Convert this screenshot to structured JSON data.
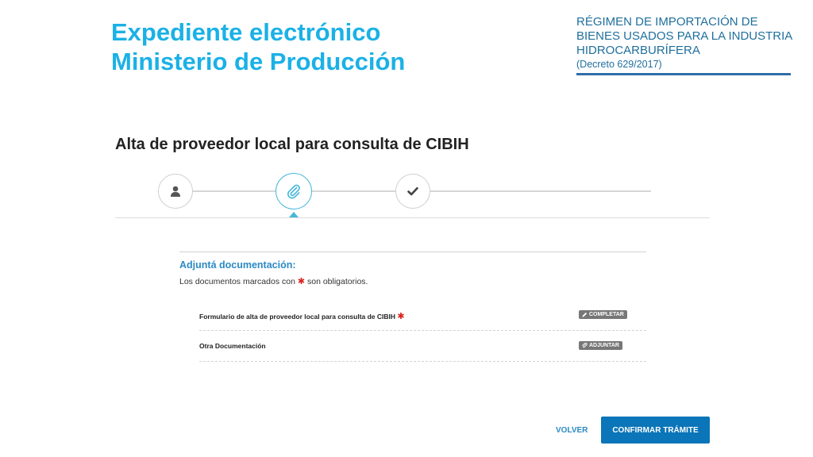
{
  "header": {
    "title_line1": "Expediente electrónico",
    "title_line2": "Ministerio de Producción",
    "regime_line1": "RÉGIMEN DE IMPORTACIÓN DE",
    "regime_line2": "BIENES USADOS PARA LA INDUSTRIA",
    "regime_line3": "HIDROCARBURÍFERA",
    "decree": "(Decreto 629/2017)"
  },
  "page_title": "Alta de proveedor local para consulta de CIBIH",
  "stepper": {
    "steps": [
      {
        "icon": "user-icon",
        "state": "done"
      },
      {
        "icon": "paperclip-icon",
        "state": "active"
      },
      {
        "icon": "check-icon",
        "state": "pending"
      }
    ]
  },
  "form": {
    "heading": "Adjuntá documentación:",
    "note_before": "Los documentos marcados con",
    "note_star": "✱",
    "note_after": "son obligatorios.",
    "documents": [
      {
        "label": "Formulario de alta de proveedor local para consulta de CIBIH",
        "required": true,
        "required_mark": "✱",
        "action_label": "COMPLETAR",
        "action_icon": "pencil-icon"
      },
      {
        "label": "Otra Documentación",
        "required": false,
        "action_label": "ADJUNTAR",
        "action_icon": "paperclip-icon"
      }
    ]
  },
  "actions": {
    "back_label": "VOLVER",
    "confirm_label": "CONFIRMAR TRÁMITE"
  },
  "colors": {
    "title": "#1ab1e6",
    "regime": "#1f6f9c",
    "accent": "#2b8ac4",
    "primary_button": "#0a75b8",
    "required": "#d9231d"
  }
}
